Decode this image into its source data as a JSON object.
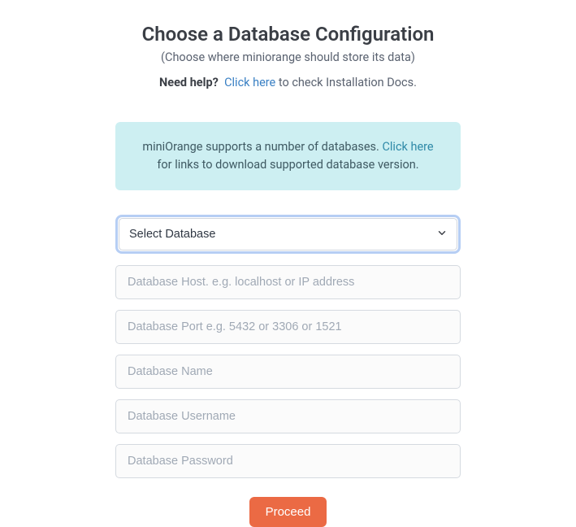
{
  "header": {
    "title": "Choose a Database Configuration",
    "subtitle": "(Choose where miniorange should store its data)"
  },
  "help": {
    "prefix": "Need help?",
    "link": "Click here",
    "suffix": " to check Installation Docs."
  },
  "info": {
    "text_before": "miniOrange supports a number of databases. ",
    "link": "Click here",
    "text_after": " for links to download supported database version."
  },
  "form": {
    "select_label": "Select Database",
    "host_placeholder": "Database Host. e.g. localhost or IP address",
    "port_placeholder": "Database Port e.g. 5432 or 3306 or 1521",
    "name_placeholder": "Database Name",
    "username_placeholder": "Database Username",
    "password_placeholder": "Database Password",
    "submit_label": "Proceed"
  }
}
